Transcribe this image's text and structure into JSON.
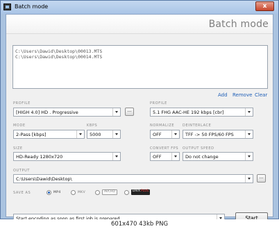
{
  "window": {
    "title": "Batch mode",
    "close_glyph": "x"
  },
  "header": {
    "title": "Batch mode"
  },
  "files": [
    "C:\\Users\\Dawid\\Desktop\\00013.MTS",
    "C:\\Users\\Dawid\\Desktop\\00014.MTS"
  ],
  "list_actions": {
    "add": "Add",
    "remove": "Remove",
    "clear": "Clear"
  },
  "video": {
    "profile_label": "PROFILE",
    "profile_value": "[HIGH 4.0] HD . Progressive",
    "mode_label": "MODE",
    "mode_value": "2-Pass [kbps]",
    "kbps_label": "KBPS",
    "kbps_value": "5000",
    "size_label": "SIZE",
    "size_value": "HD-Ready     1280x720"
  },
  "audio": {
    "profile_label": "PROFILE",
    "profile_value": "5.1 FHG AAC-HE        192 kbps [cbr]",
    "normalize_label": "NORMALIZE",
    "normalize_value": "OFF",
    "deinterlace_label": "DEINTERLACE",
    "deinterlace_value": "TFF -> 50 FPS/60 FPS",
    "convert_fps_label": "CONVERT FPS",
    "convert_fps_value": "OFF",
    "output_speed_label": "OUTPUT SPEED",
    "output_speed_value": "Do not change"
  },
  "output": {
    "label": "OUTPUT",
    "path": "C:\\Users\\Dawid\\Desktop\\"
  },
  "browse_label": "...",
  "save_as": {
    "label": "SAVE AS",
    "options": [
      "MP4",
      "MKV",
      "AVCHD",
      "DIVX PLUS"
    ],
    "divx_part1": "DIVX",
    "divx_part2": "PLUS",
    "selected": "MP4"
  },
  "footer": {
    "option_value": "Start encoding as soon as first job is prepared",
    "start_label": "Start"
  },
  "caption": "601x470 43kb PNG",
  "colors": {
    "link": "#1f5fb7",
    "divx_badge": "#cc0000",
    "title_bar": "#a9c4e6"
  }
}
